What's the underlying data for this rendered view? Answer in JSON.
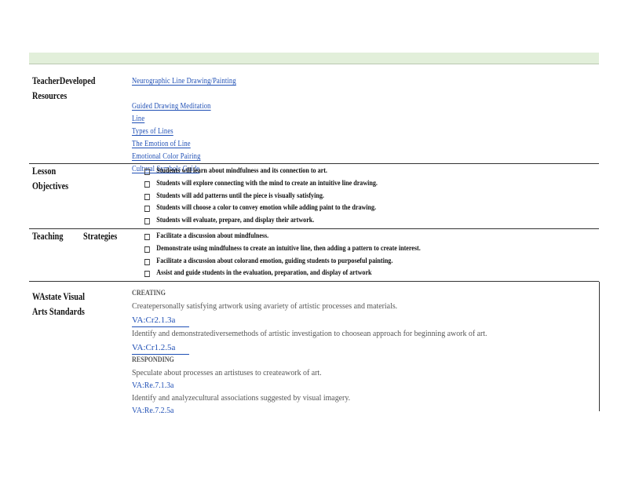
{
  "resources": {
    "label": "TeacherDeveloped\nResources",
    "links": [
      "Neurographic Line Drawing/Painting",
      "",
      "Guided Drawing Meditation",
      "Line",
      "Types of Lines",
      "The Emotion of Line",
      "Emotional Color Pairing",
      "Cultural Symbols Guide"
    ]
  },
  "objectives": {
    "label": "Lesson\nObjectives",
    "items": [
      "Students will learn about mindfulness and its connection to art.",
      "Students will explore connecting with the mind to create an intuitive line drawing.",
      "Students will add patterns until the piece is visually satisfying.",
      "Students will choose a color to convey emotion while adding paint to the drawing.",
      "Students will evaluate, prepare, and display their artwork."
    ]
  },
  "strategies": {
    "label": "Teaching Strategies",
    "items": [
      "Facilitate a discussion about mindfulness.",
      "Demonstrate using mindfulness to create an intuitive line, then adding a pattern to create interest.",
      "Facilitate a discussion about colorand emotion, guiding students to purposeful painting.",
      "Assist and guide students in the evaluation, preparation, and display of artwork"
    ]
  },
  "standards": {
    "label": "WAstate Visual\nArts Standards",
    "creating_head": "CREATING",
    "c1_text": "Createpersonally satisfying artwork using avariety of artistic processes and materials.",
    "c1_code": "VA:Cr2.1.3a",
    "c2_text": "Identify and demonstratediversemethods of artistic investigation to choosean approach for beginning awork of art.",
    "c2_code": "VA:Cr1.2.5a",
    "responding_head": "RESPONDING",
    "r1_text": "Speculate about processes an artistuses to createawork of art.",
    "r1_code": "VA:Re.7.1.3a",
    "r2_text": "Identify and analyzecultural associations suggested by visual imagery.",
    "r2_code": "VA:Re.7.2.5a"
  },
  "colors": {
    "header_band": "#e2efda",
    "link": "#1f4fb5"
  },
  "icons": {
    "bullet": "checkbox-bullet-icon"
  }
}
